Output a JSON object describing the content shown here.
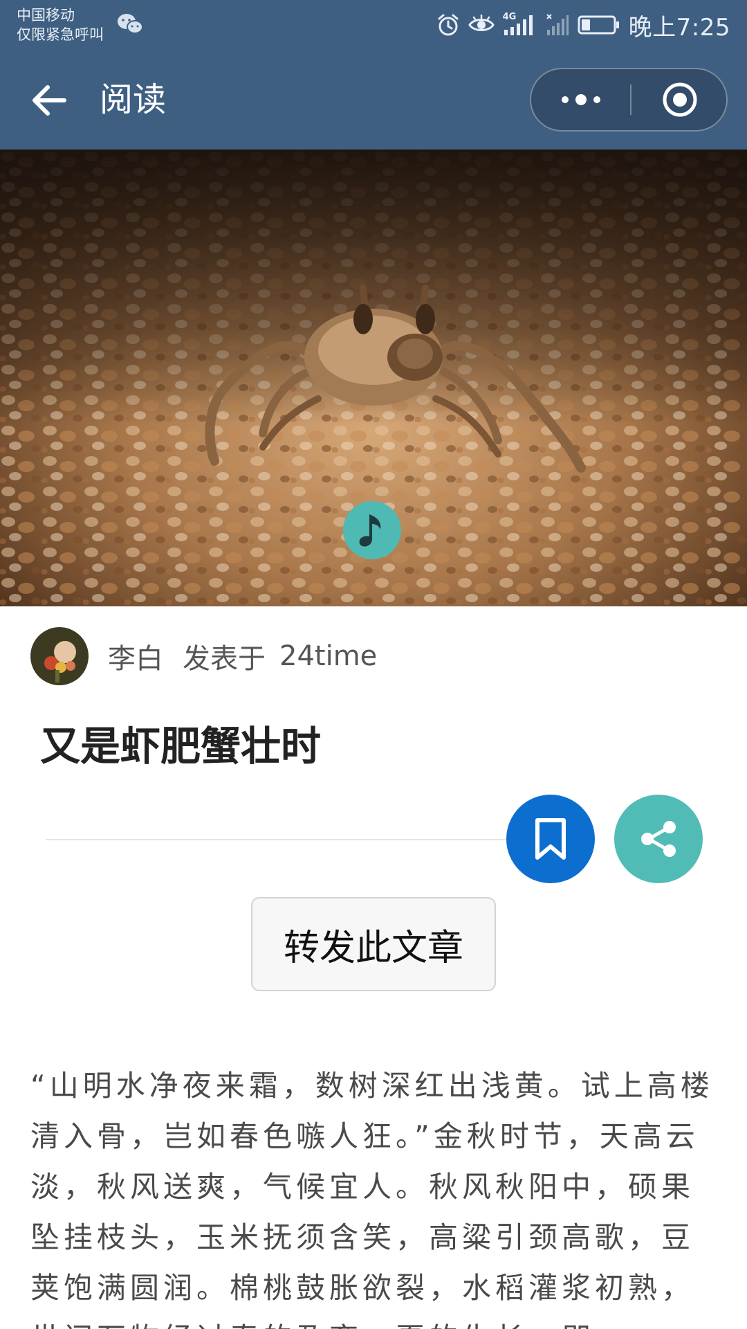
{
  "status_bar": {
    "carrier_line1": "中国移动",
    "carrier_line2": "仅限紧急呼叫",
    "network": "4G",
    "time": "晚上7:25"
  },
  "nav": {
    "title": "阅读"
  },
  "author": {
    "name": "李白",
    "publish_text": "发表于",
    "publish_target": "24time"
  },
  "article": {
    "title": "又是虾肥蟹壮时",
    "forward_label": "转发此文章",
    "body": "“山明水净夜来霜，数树深红出浅黄。试上高楼清入骨，岂如春色嗾人狂。”金秋时节，天高云淡，秋风送爽，气候宜人。秋风秋阳中，硕果坠挂枝头，玉米抚须含笑，高粱引颈高歌，豆荚饱满圆润。棉桃鼓胀欲裂，水稻灌浆初熟，世间万物经过春的孕育，夏的生长，即"
  },
  "colors": {
    "nav_bg": "#3f5f82",
    "bookmark_bg": "#0c6fd0",
    "share_bg": "#51bcb6",
    "music_bg": "#4fb9b4"
  },
  "icons": {
    "back": "arrow-left-icon",
    "more": "more-dots-icon",
    "close": "close-target-icon",
    "music": "music-note-icon",
    "bookmark": "bookmark-icon",
    "share": "share-icon"
  }
}
